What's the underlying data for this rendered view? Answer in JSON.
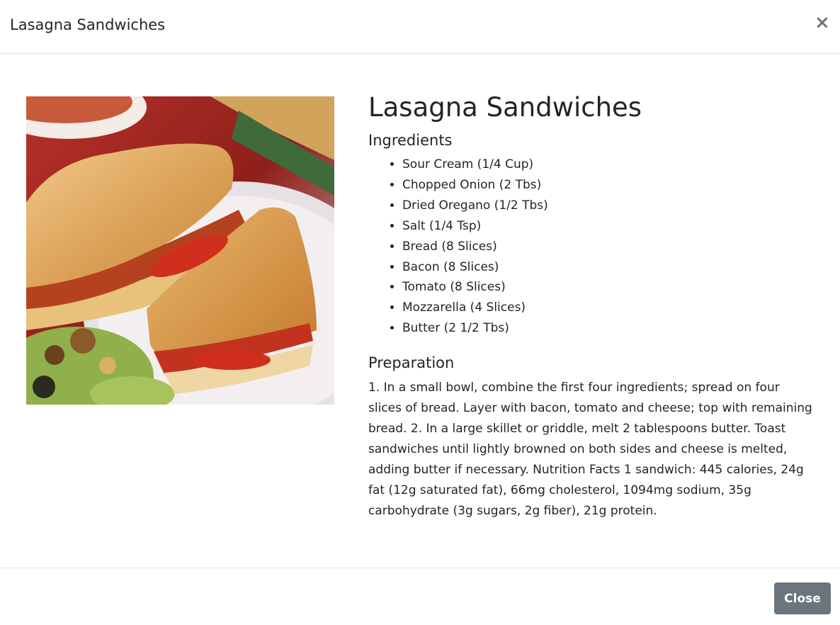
{
  "modal": {
    "header_title": "Lasagna Sandwiches",
    "close_icon": "close-icon",
    "close_glyph": "×"
  },
  "recipe": {
    "image": "lasagna-sandwiches-photo",
    "title": "Lasagna Sandwiches",
    "ingredients_heading": "Ingredients",
    "ingredients": [
      "Sour Cream (1/4 Cup)",
      "Chopped Onion (2 Tbs)",
      "Dried Oregano (1/2 Tbs)",
      "Salt (1/4 Tsp)",
      "Bread (8 Slices)",
      "Bacon (8 Slices)",
      "Tomato (8 Slices)",
      "Mozzarella (4 Slices)",
      "Butter (2 1/2 Tbs)"
    ],
    "preparation_heading": "Preparation",
    "preparation": "1. In a small bowl, combine the first four ingredients; spread on four slices of bread. Layer with bacon, tomato and cheese; top with remaining bread. 2. In a large skillet or griddle, melt 2 tablespoons butter. Toast sandwiches until lightly browned on both sides and cheese is melted, adding butter if necessary. Nutrition Facts 1 sandwich: 445 calories, 24g fat (12g saturated fat), 66mg cholesterol, 1094mg sodium, 35g carbohydrate (3g sugars, 2g fiber), 21g protein."
  },
  "footer": {
    "close_label": "Close",
    "close_color": "#6c757d"
  }
}
